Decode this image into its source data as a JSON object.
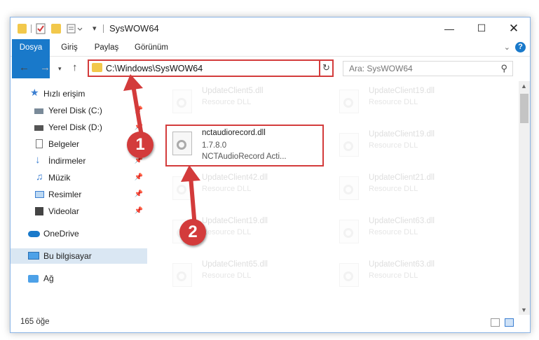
{
  "window": {
    "title": "SysWOW64"
  },
  "ribbon": {
    "tabs": [
      "Dosya",
      "Giriş",
      "Paylaş",
      "Görünüm"
    ],
    "help": "?"
  },
  "address": {
    "path": "C:\\Windows\\SysWOW64",
    "search_placeholder": "Ara: SysWOW64"
  },
  "sidebar": {
    "items": [
      {
        "label": "Hızlı erişim",
        "icon": "star-icon"
      },
      {
        "label": "Yerel Disk (C:)",
        "icon": "drive-icon",
        "pinned": true
      },
      {
        "label": "Yerel Disk (D:)",
        "icon": "drive-icon",
        "pinned": true
      },
      {
        "label": "Belgeler",
        "icon": "documents-icon",
        "pinned": true
      },
      {
        "label": "İndirmeler",
        "icon": "download-icon",
        "pinned": true
      },
      {
        "label": "Müzik",
        "icon": "music-icon",
        "pinned": true
      },
      {
        "label": "Resimler",
        "icon": "pictures-icon",
        "pinned": true
      },
      {
        "label": "Videolar",
        "icon": "videos-icon",
        "pinned": true
      },
      {
        "label": "OneDrive",
        "icon": "cloud-icon"
      },
      {
        "label": "Bu bilgisayar",
        "icon": "computer-icon",
        "selected": true
      },
      {
        "label": "Ağ",
        "icon": "network-icon"
      }
    ]
  },
  "files": {
    "left": [
      {
        "name": "UpdateClient5.dll",
        "desc": "Resource DLL"
      },
      {
        "name": "nctaudiorecord.dll",
        "desc": "1.7.8.0",
        "desc2": "NCTAudioRecord Acti...",
        "highlighted": true
      },
      {
        "name": "UpdateClient42.dll",
        "desc": "Resource DLL"
      },
      {
        "name": "UpdateClient19.dll",
        "desc": "Resource DLL"
      },
      {
        "name": "UpdateClient65.dll",
        "desc": "Resource DLL"
      }
    ],
    "right": [
      {
        "name": "UpdateClient19.dll",
        "desc": "Resource DLL"
      },
      {
        "name": "UpdateClient19.dll",
        "desc": "Resource DLL"
      },
      {
        "name": "UpdateClient21.dll",
        "desc": "Resource DLL"
      },
      {
        "name": "UpdateClient63.dll",
        "desc": "Resource DLL"
      },
      {
        "name": "UpdateClient63.dll",
        "desc": "Resource DLL"
      }
    ]
  },
  "status": {
    "count": "165 öğe"
  },
  "markers": [
    "1",
    "2"
  ],
  "colors": {
    "accent": "#1979ca",
    "highlight": "#d33b3b",
    "selected": "#dae7f3"
  }
}
